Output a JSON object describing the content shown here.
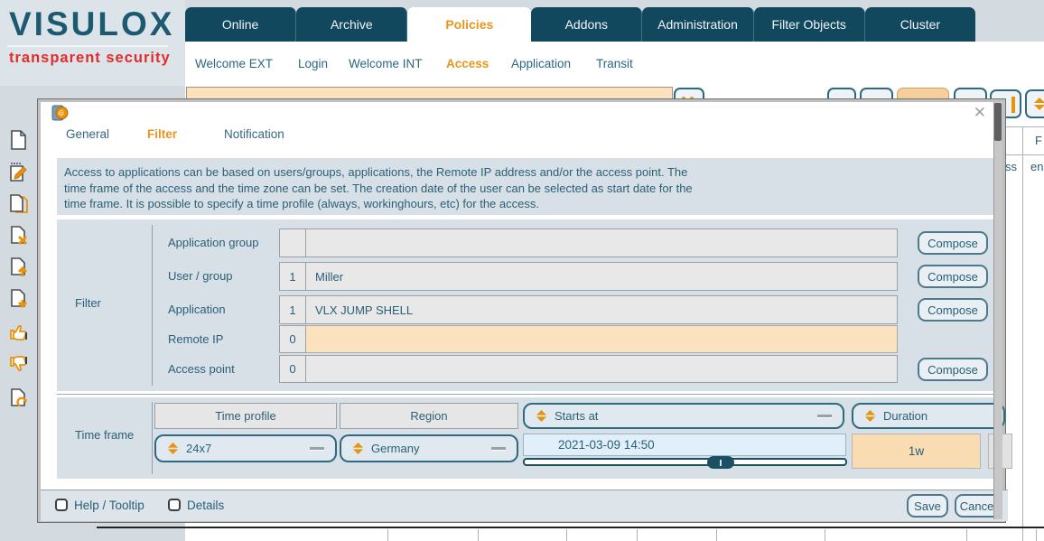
{
  "brand": {
    "name": "VISULOX",
    "tagline": "transparent security"
  },
  "top_nav": {
    "tabs": [
      {
        "label": "Online",
        "active": false
      },
      {
        "label": "Archive",
        "active": false
      },
      {
        "label": "Policies",
        "active": true
      },
      {
        "label": "Addons",
        "active": false
      },
      {
        "label": "Administration",
        "active": false
      },
      {
        "label": "Filter Objects",
        "active": false
      },
      {
        "label": "Cluster",
        "active": false
      }
    ]
  },
  "sub_nav": {
    "items": [
      {
        "label": "Welcome EXT",
        "active": false
      },
      {
        "label": "Login",
        "active": false
      },
      {
        "label": "Welcome INT",
        "active": false
      },
      {
        "label": "Access",
        "active": true
      },
      {
        "label": "Application",
        "active": false
      },
      {
        "label": "Transit",
        "active": false
      }
    ]
  },
  "sidebar": {
    "icons": [
      "new-document",
      "edit-document",
      "duplicate-document",
      "delete-document",
      "upload-document",
      "download-document",
      "thumbs-up",
      "thumbs-down",
      "refresh-document"
    ]
  },
  "background_table": {
    "partial_column_header": "F",
    "partial_cell_a": "ss",
    "partial_cell_b": "en"
  },
  "dialog": {
    "tabs": [
      {
        "label": "General",
        "active": false
      },
      {
        "label": "Filter",
        "active": true
      },
      {
        "label": "Notification",
        "active": false
      }
    ],
    "description_lines": [
      "Access to applications can be based on users/groups, applications, the Remote IP address and/or the access point. The",
      "time frame of the access and the time zone can be set. The creation date of the user can be selected as start date for the",
      "time frame. It is possible to specify a time profile (always, workinghours, etc) for the access."
    ],
    "filter": {
      "section_label": "Filter",
      "compose_label": "Compose",
      "rows": [
        {
          "label": "Application group",
          "count": "",
          "value": "",
          "compose": true,
          "highlight": false
        },
        {
          "label": "User / group",
          "count": "1",
          "value": "Miller",
          "compose": true,
          "highlight": false
        },
        {
          "label": "Application",
          "count": "1",
          "value": "VLX JUMP SHELL",
          "compose": true,
          "highlight": false
        },
        {
          "label": "Remote IP",
          "count": "0",
          "value": "",
          "compose": false,
          "highlight": true
        },
        {
          "label": "Access point",
          "count": "0",
          "value": "",
          "compose": true,
          "highlight": false
        }
      ]
    },
    "time_frame": {
      "section_label": "Time frame",
      "headers": {
        "time_profile": "Time profile",
        "region": "Region",
        "starts_at": "Starts at",
        "duration": "Duration"
      },
      "values": {
        "time_profile": "24x7",
        "region": "Germany",
        "starts_at": "2021-03-09 14:50",
        "duration": "1w"
      }
    },
    "footer": {
      "checkboxes": [
        {
          "label": "Help / Tooltip",
          "checked": false
        },
        {
          "label": "Details",
          "checked": false
        }
      ],
      "save_label": "Save",
      "cancel_label": "Cancel"
    }
  },
  "colors": {
    "nav_teal": "#11485e",
    "accent_orange": "#e8951c",
    "icon_orange": "#e8930c",
    "highlight_peach": "#fbe2bf",
    "text_teal": "#2a6076"
  }
}
